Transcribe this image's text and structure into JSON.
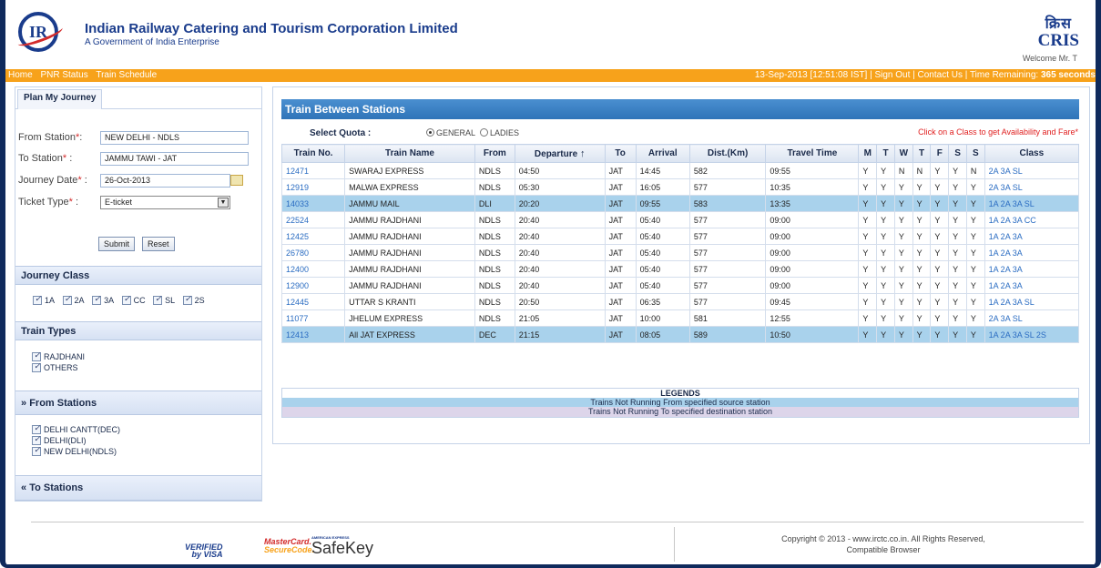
{
  "header": {
    "org_title": "Indian Railway Catering and Tourism Corporation Limited",
    "org_subtitle": "A Government of India Enterprise",
    "cris_hindi": "क्रिस",
    "cris_english": "CRIS",
    "welcome": "Welcome Mr. T"
  },
  "nav": {
    "links": [
      "Home",
      "PNR Status",
      "Train Schedule"
    ],
    "status_text": "13-Sep-2013 [12:51:08 IST] | Sign Out | Contact Us | Time Remaining:",
    "time_remaining": "365 seconds"
  },
  "sidebar": {
    "tab": "Plan My Journey",
    "from_label": "From Station",
    "from_value": "NEW DELHI - NDLS",
    "to_label": "To Station",
    "to_value": "JAMMU TAWI - JAT",
    "date_label": "Journey Date",
    "date_value": "26-Oct-2013",
    "ticket_label": "Ticket Type",
    "ticket_value": "E-ticket",
    "submit": "Submit",
    "reset": "Reset",
    "journey_class_head": "Journey Class",
    "classes": [
      "1A",
      "2A",
      "3A",
      "CC",
      "SL",
      "2S"
    ],
    "train_types_head": "Train Types",
    "train_types": [
      "RAJDHANI",
      "OTHERS"
    ],
    "from_stations_head": "From Stations",
    "from_stations": [
      "DELHI CANTT(DEC)",
      "DELHI(DLI)",
      "NEW DELHI(NDLS)"
    ],
    "to_stations_head": "To Stations"
  },
  "main": {
    "title": "Train Between Stations",
    "quota_label": "Select Quota :",
    "quota_options": [
      "GENERAL",
      "LADIES"
    ],
    "hint": "Click on a Class to get Availability and Fare*",
    "columns": [
      "Train No.",
      "Train Name",
      "From",
      "Departure",
      "To",
      "Arrival",
      "Dist.(Km)",
      "Travel Time",
      "M",
      "T",
      "W",
      "T",
      "F",
      "S",
      "S",
      "Class"
    ],
    "rows": [
      [
        "12471",
        "SWARAJ EXPRESS",
        "NDLS",
        "04:50",
        "JAT",
        "14:45",
        "582",
        "09:55",
        "Y",
        "Y",
        "N",
        "N",
        "Y",
        "Y",
        "N",
        "2A 3A SL"
      ],
      [
        "12919",
        "MALWA EXPRESS",
        "NDLS",
        "05:30",
        "JAT",
        "16:05",
        "577",
        "10:35",
        "Y",
        "Y",
        "Y",
        "Y",
        "Y",
        "Y",
        "Y",
        "2A 3A SL"
      ],
      [
        "14033",
        "JAMMU MAIL",
        "DLI",
        "20:20",
        "JAT",
        "09:55",
        "583",
        "13:35",
        "Y",
        "Y",
        "Y",
        "Y",
        "Y",
        "Y",
        "Y",
        "1A 2A 3A SL"
      ],
      [
        "22524",
        "JAMMU RAJDHANI",
        "NDLS",
        "20:40",
        "JAT",
        "05:40",
        "577",
        "09:00",
        "Y",
        "Y",
        "Y",
        "Y",
        "Y",
        "Y",
        "Y",
        "1A 2A 3A CC"
      ],
      [
        "12425",
        "JAMMU RAJDHANI",
        "NDLS",
        "20:40",
        "JAT",
        "05:40",
        "577",
        "09:00",
        "Y",
        "Y",
        "Y",
        "Y",
        "Y",
        "Y",
        "Y",
        "1A 2A 3A"
      ],
      [
        "26780",
        "JAMMU RAJDHANI",
        "NDLS",
        "20:40",
        "JAT",
        "05:40",
        "577",
        "09:00",
        "Y",
        "Y",
        "Y",
        "Y",
        "Y",
        "Y",
        "Y",
        "1A 2A 3A"
      ],
      [
        "12400",
        "JAMMU RAJDHANI",
        "NDLS",
        "20:40",
        "JAT",
        "05:40",
        "577",
        "09:00",
        "Y",
        "Y",
        "Y",
        "Y",
        "Y",
        "Y",
        "Y",
        "1A 2A 3A"
      ],
      [
        "12900",
        "JAMMU RAJDHANI",
        "NDLS",
        "20:40",
        "JAT",
        "05:40",
        "577",
        "09:00",
        "Y",
        "Y",
        "Y",
        "Y",
        "Y",
        "Y",
        "Y",
        "1A 2A 3A"
      ],
      [
        "12445",
        "UTTAR S KRANTI",
        "NDLS",
        "20:50",
        "JAT",
        "06:35",
        "577",
        "09:45",
        "Y",
        "Y",
        "Y",
        "Y",
        "Y",
        "Y",
        "Y",
        "1A 2A 3A SL"
      ],
      [
        "11077",
        "JHELUM EXPRESS",
        "NDLS",
        "21:05",
        "JAT",
        "10:00",
        "581",
        "12:55",
        "Y",
        "Y",
        "Y",
        "Y",
        "Y",
        "Y",
        "Y",
        "2A 3A SL"
      ],
      [
        "12413",
        "All JAT EXPRESS",
        "DEC",
        "21:15",
        "JAT",
        "08:05",
        "589",
        "10:50",
        "Y",
        "Y",
        "Y",
        "Y",
        "Y",
        "Y",
        "Y",
        "1A 2A 3A SL 2S"
      ]
    ],
    "highlighted_rows": [
      2,
      10
    ],
    "legends_title": "LEGENDS",
    "legend_source": "Trains Not Running From specified source station",
    "legend_dest": "Trains Not Running To specified destination station"
  },
  "footer": {
    "visa_1": "VERIFIED",
    "visa_2": "by VISA",
    "mc_1": "MasterCard.",
    "mc_2": "SecureCode.",
    "amex_small": "AMERICAN EXPRESS",
    "safekey": "SafeKey",
    "copyright": "Copyright © 2013 - www.irctc.co.in. All Rights Reserved,",
    "browser": "Compatible Browser"
  },
  "colors": {
    "brand_blue": "#1a3c8c",
    "nav_orange": "#f7a21b",
    "panel_blue": "#2f74b8",
    "row_highlight": "#a9d2ec",
    "legend_dest": "#ddd5ea",
    "link_blue": "#2a6cc2"
  }
}
